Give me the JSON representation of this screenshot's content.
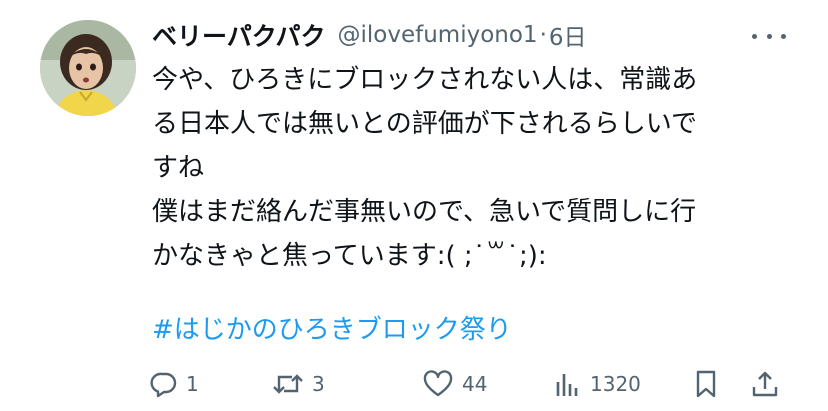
{
  "tweet": {
    "display_name": "ベリーパクパク",
    "handle": "@ilovefumiyono1",
    "separator": "·",
    "time": "6日",
    "body_lines": [
      "今や、ひろきにブロックされない人は、常識あ",
      "る日本人では無いとの評価が下されるらしいで",
      "すね",
      "僕はまだ絡んだ事無いので、急いで質問しに行",
      "かなきゃと焦っています:( ;˙꒳˙;):"
    ],
    "hashtag": "#はじかのひろきブロック祭り"
  },
  "actions": {
    "reply_count": "1",
    "retweet_count": "3",
    "like_count": "44",
    "view_count": "1320"
  },
  "icons": {
    "reply": "reply-icon",
    "retweet": "retweet-icon",
    "like": "heart-icon",
    "views": "views-icon",
    "bookmark": "bookmark-icon",
    "share": "share-icon",
    "more": "more-icon"
  },
  "colors": {
    "text": "#0f1419",
    "secondary": "#536471",
    "link": "#1d9bf0"
  }
}
